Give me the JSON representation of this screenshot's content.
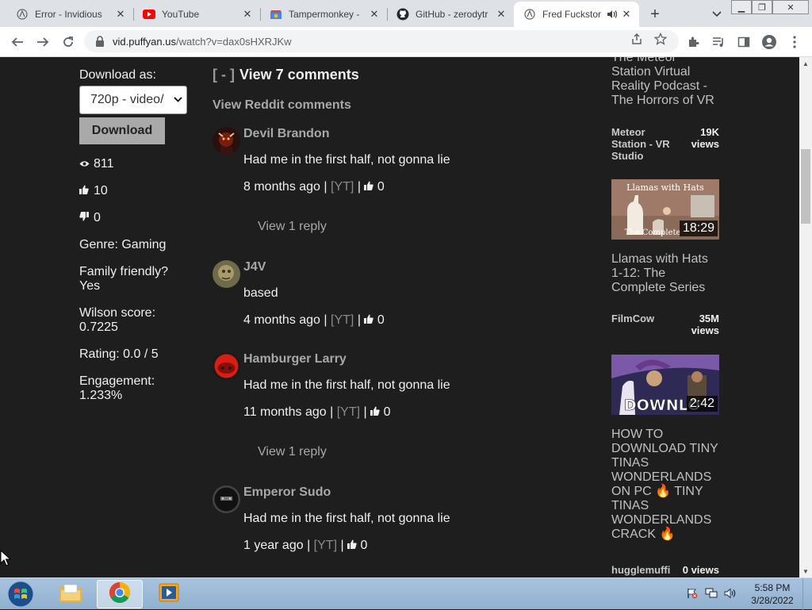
{
  "browser": {
    "tabs": [
      {
        "title": "Error - Invidious",
        "icon": "invidious-icon",
        "active": false
      },
      {
        "title": "YouTube",
        "icon": "youtube-icon",
        "active": false
      },
      {
        "title": "Tampermonkey - ",
        "icon": "chrome-webstore-icon",
        "active": false
      },
      {
        "title": "GitHub - zerodytr",
        "icon": "github-icon",
        "active": false
      },
      {
        "title": "Fred Fuckstor",
        "icon": "invidious-icon",
        "active": true
      }
    ],
    "new_tab_symbol": "+",
    "url_domain": "vid.puffyan.us",
    "url_path": "/watch?v=dax0sHXRJKw"
  },
  "player_panel": {
    "download_label": "Download as:",
    "format_selected": "720p - video/",
    "download_button": "Download",
    "views": "811",
    "likes": "10",
    "dislikes": "0",
    "genre": "Genre: Gaming",
    "family_friendly_label": "Family friendly?",
    "family_friendly_value": "Yes",
    "wilson_label": "Wilson score:",
    "wilson_value": "0.7225",
    "rating": "Rating: 0.0 / 5",
    "engagement_label": "Engagement:",
    "engagement_value": "1.233%"
  },
  "comments": {
    "toggle": "[ - ]",
    "header": "View 7 comments",
    "reddit_link": "View Reddit comments",
    "items": [
      {
        "author": "Devil Brandon",
        "text": "Had me in the first half, not gonna lie",
        "time": "8 months ago",
        "yt": "[YT]",
        "likes": "0",
        "reply": "View 1 reply"
      },
      {
        "author": "J4V",
        "text": "based",
        "time": "4 months ago",
        "yt": "[YT]",
        "likes": "0",
        "reply": ""
      },
      {
        "author": "Hamburger Larry",
        "text": "Had me in the first half, not gonna lie",
        "time": "11 months ago",
        "yt": "[YT]",
        "likes": "0",
        "reply": "View 1 reply"
      },
      {
        "author": "Emperor Sudo",
        "text": "Had me in the first half, not gonna lie",
        "time": "1 year ago",
        "yt": "[YT]",
        "likes": "0",
        "reply": ""
      }
    ],
    "separator": "|"
  },
  "sidebar": {
    "top_partial_title": "The Meteor Station Virtual Reality Podcast - The Horrors of VR",
    "top_partial_title_visible_first": "The Meteor",
    "top_title_rest": "Station Virtual Reality Podcast - The Horrors of VR",
    "videos": [
      {
        "channel": "Meteor Station - VR Studio",
        "views": "19K views"
      },
      {
        "thumb_caption": "Llamas with Hats",
        "thumb_subcaption": "The Complete",
        "length": "18:29",
        "title": "Llamas with Hats 1-12: The Complete Series",
        "channel": "FilmCow",
        "views": "35M views"
      },
      {
        "thumb_caption": "DOWNLO",
        "length": "2:42",
        "title": "HOW TO DOWNLOAD TINY TINAS WONDERLANDS ON PC 🔥 TINY TINAS WONDERLANDS CRACK 🔥",
        "channel": "hugglemuffi",
        "views": "0 views"
      }
    ]
  },
  "taskbar": {
    "time": "5:58 PM",
    "date": "3/28/2022"
  },
  "colors": {
    "page_bg": "#1e1e1e",
    "link_gray": "#a8a8a8",
    "text_light": "#f0f0f0"
  }
}
